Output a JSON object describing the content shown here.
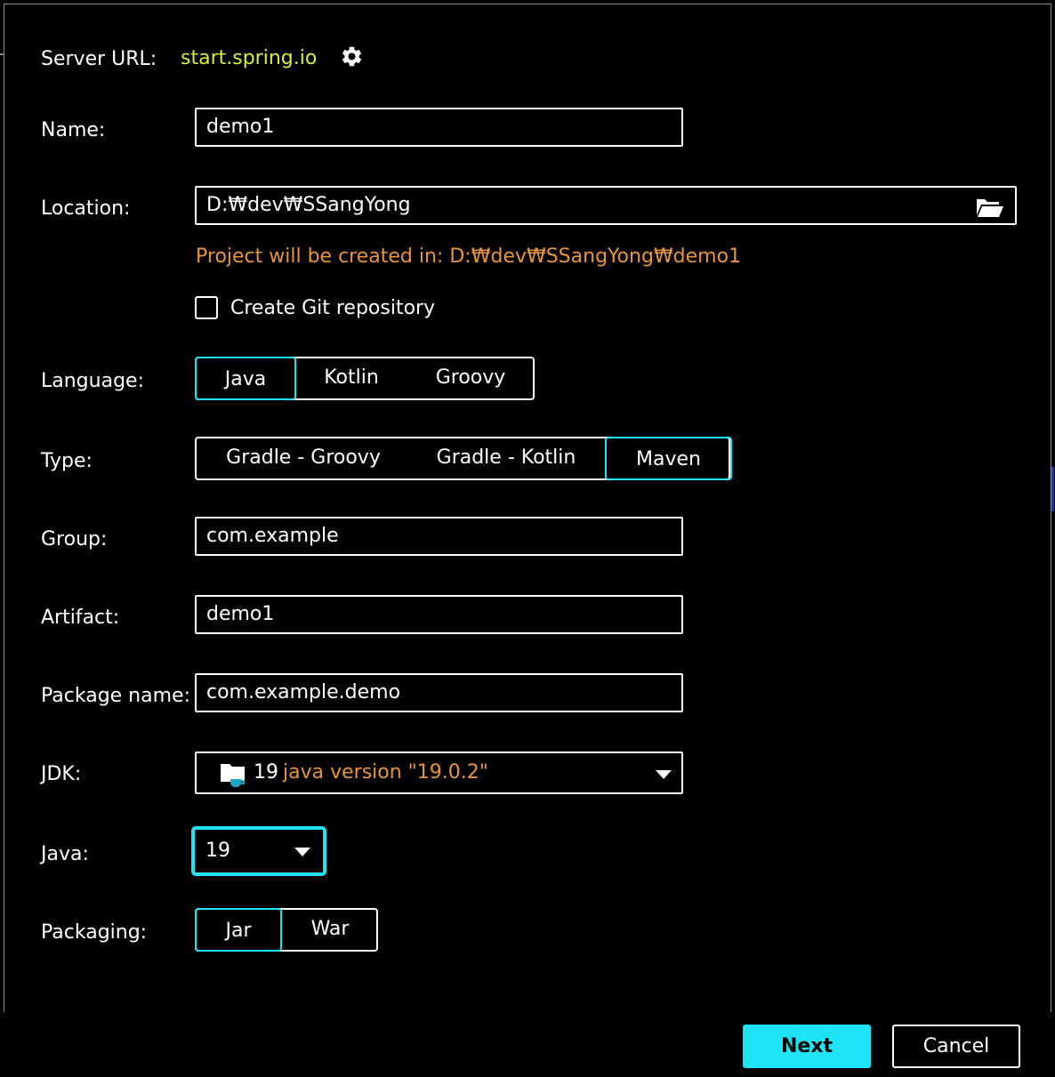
{
  "server": {
    "label": "Server URL:",
    "url": "start.spring.io",
    "settings_icon": "gear-icon"
  },
  "name": {
    "label": "Name:",
    "value": "demo1"
  },
  "location": {
    "label": "Location:",
    "value": "D:₩dev₩SSangYong",
    "browse_icon": "folder-open-icon",
    "hint": "Project will be created in: D:₩dev₩SSangYong₩demo1"
  },
  "git": {
    "label": "Create Git repository",
    "checked": false
  },
  "language": {
    "label": "Language:",
    "options": [
      "Java",
      "Kotlin",
      "Groovy"
    ],
    "selected": "Java"
  },
  "type": {
    "label": "Type:",
    "options": [
      "Gradle - Groovy",
      "Gradle - Kotlin",
      "Maven"
    ],
    "selected": "Maven"
  },
  "group": {
    "label": "Group:",
    "value": "com.example"
  },
  "artifact": {
    "label": "Artifact:",
    "value": "demo1"
  },
  "package": {
    "label": "Package name:",
    "value": "com.example.demo"
  },
  "jdk": {
    "label": "JDK:",
    "number": "19",
    "version": "java version \"19.0.2\"",
    "icon": "jdk-folder-icon"
  },
  "java": {
    "label": "Java:",
    "value": "19"
  },
  "packaging": {
    "label": "Packaging:",
    "options": [
      "Jar",
      "War"
    ],
    "selected": "Jar"
  },
  "buttons": {
    "next": "Next",
    "cancel": "Cancel"
  },
  "colors": {
    "accent": "#1ee3f5",
    "link": "#d8ec3a",
    "hint": "#e8943a",
    "background": "#000000",
    "foreground": "#ffffff"
  }
}
